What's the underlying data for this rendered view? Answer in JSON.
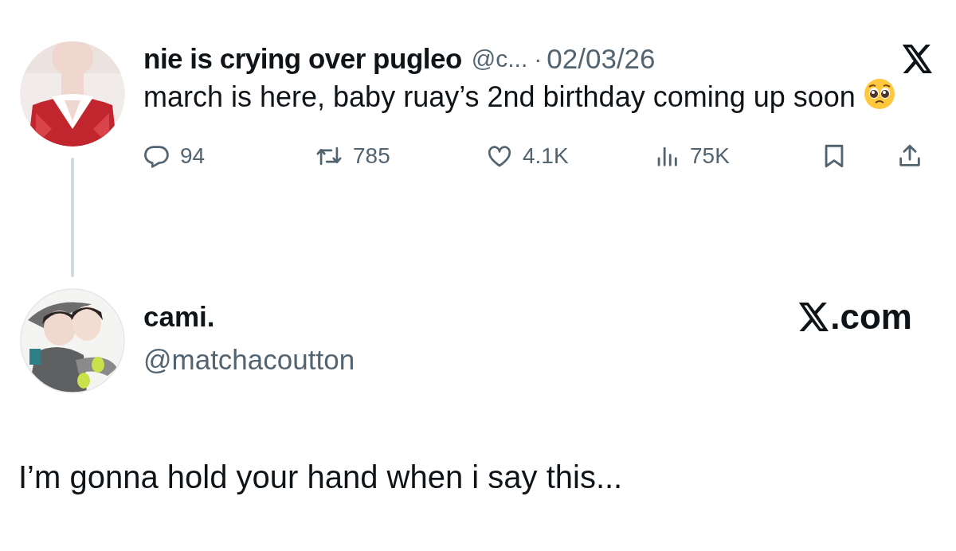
{
  "tweet": {
    "display_name": "nie is crying over pugleo",
    "handle": "@c...",
    "separator": "·",
    "date": "02/03/26",
    "text": "march is here, baby ruay’s 2nd birthday coming up soon",
    "actions": [
      {
        "kind": "reply",
        "count": "94"
      },
      {
        "kind": "repost",
        "count": "785"
      },
      {
        "kind": "like",
        "count": "4.1K"
      },
      {
        "kind": "views",
        "count": "75K"
      },
      {
        "kind": "bookmark"
      },
      {
        "kind": "share"
      }
    ]
  },
  "reply_author": {
    "display_name": "cami.",
    "handle": "@matchacoutton",
    "site": ".com"
  },
  "caption": "I’m gonna hold your hand when i say this..."
}
